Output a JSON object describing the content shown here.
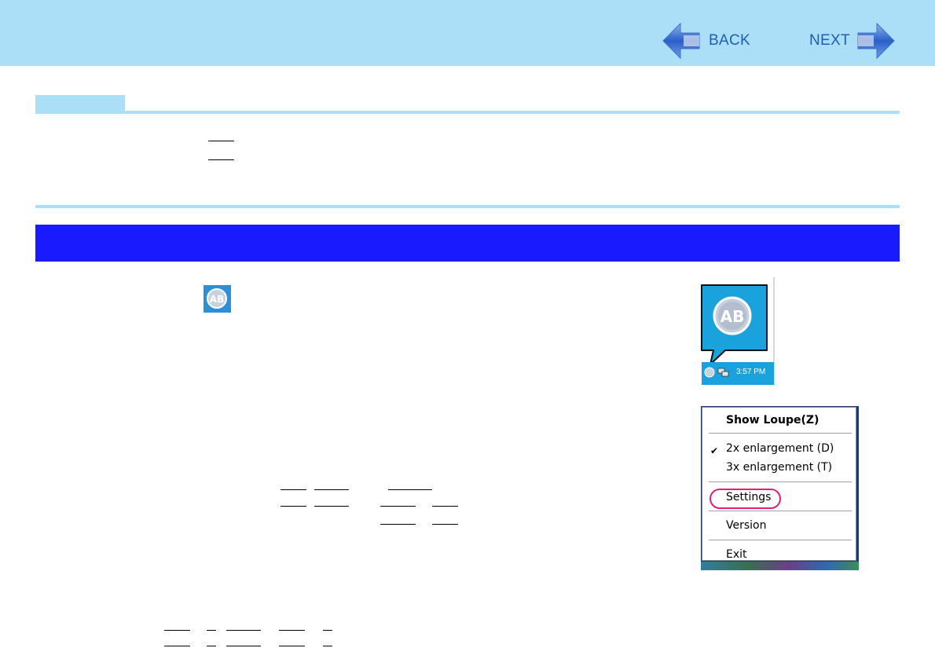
{
  "nav": {
    "back_label": "BACK",
    "next_label": "NEXT",
    "accent_color": "#1f5fb5",
    "bar_color": "#aadff7"
  },
  "section": {
    "bar_color": "#1a1aff"
  },
  "tray_figure": {
    "icon_text": "AB",
    "clock": "3:57 PM"
  },
  "context_menu": {
    "items": [
      {
        "label": "Show Loupe(Z)",
        "bold": true
      },
      {
        "label": "2x enlargement (D)",
        "checked": true
      },
      {
        "label": "3x enlargement (T)"
      },
      {
        "label": "Settings",
        "highlighted": true
      },
      {
        "label": "Version"
      },
      {
        "label": "Exit"
      }
    ],
    "highlight_color": "#e0207a"
  }
}
